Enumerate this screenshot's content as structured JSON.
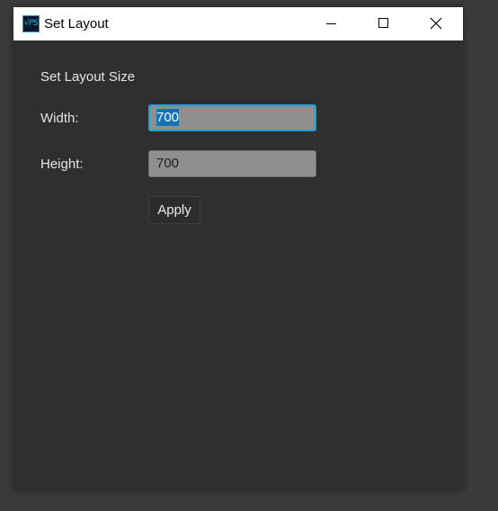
{
  "window": {
    "title": "Set Layout",
    "app_icon_text": "√PS"
  },
  "form": {
    "heading": "Set Layout Size",
    "width_label": "Width:",
    "width_value": "700",
    "height_label": "Height:",
    "height_value": "700",
    "apply_label": "Apply"
  },
  "colors": {
    "background": "#2f2f2f",
    "titlebar": "#ffffff",
    "field": "#8f8f8f",
    "focus_border": "#1ea3d8",
    "selection": "#1473b7"
  }
}
